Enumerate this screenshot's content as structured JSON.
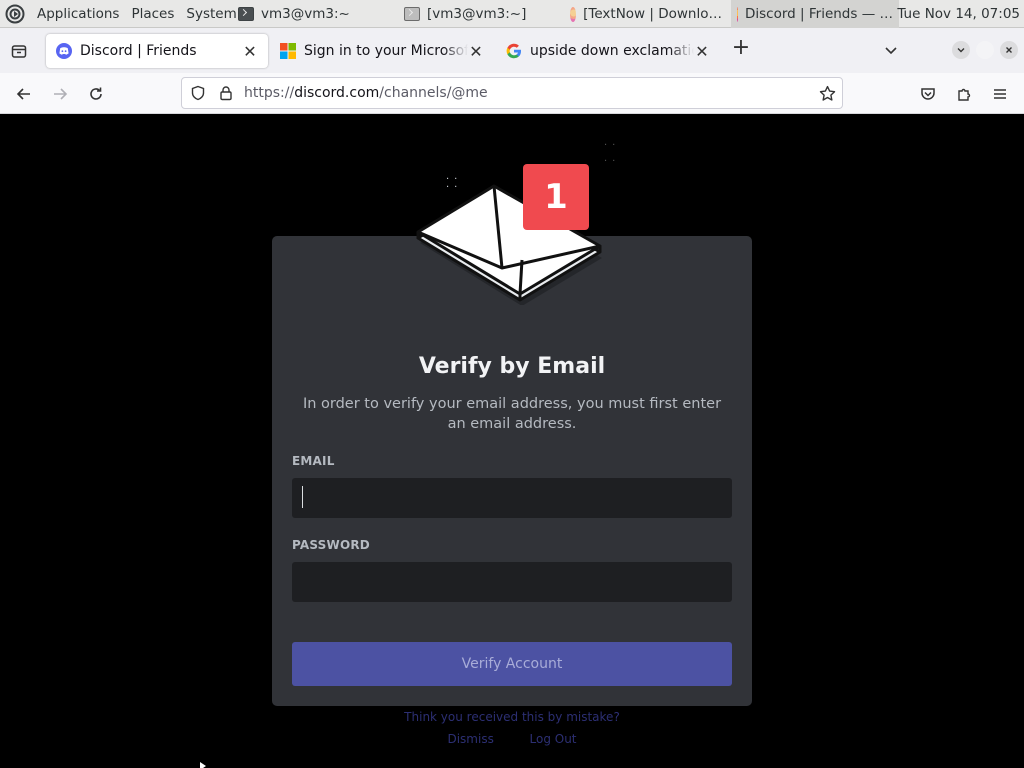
{
  "panel": {
    "menus": [
      "Applications",
      "Places",
      "System"
    ],
    "tasks": [
      {
        "label": "vm3@vm3:~",
        "icon": "terminal-icon"
      },
      {
        "label": "[vm3@vm3:~]",
        "icon": "terminal-icon"
      },
      {
        "label": "[TextNow | Downlo…",
        "icon": "firefox-icon"
      },
      {
        "label": "Discord | Friends — …",
        "icon": "firefox-icon"
      }
    ],
    "clock": "Tue Nov 14, 07:05"
  },
  "tabs": [
    {
      "title": "Discord | Friends",
      "favicon": "discord-icon",
      "selected": true
    },
    {
      "title": "Sign in to your Microsoft account",
      "favicon": "microsoft-icon",
      "selected": false
    },
    {
      "title": "upside down exclamation point",
      "favicon": "google-icon",
      "selected": false
    }
  ],
  "navbar": {
    "url_prefix": "https://",
    "url_host": "discord.com",
    "url_path": "/channels/@me"
  },
  "modal": {
    "badge_count": "1",
    "title": "Verify by Email",
    "description": "In order to verify your email address, you must first enter an email address.",
    "email_label": "EMAIL",
    "email_value": "",
    "password_label": "PASSWORD",
    "password_value": "",
    "button_label": "Verify Account"
  },
  "behind": {
    "line1": "Think you received this by mistake?",
    "link_left": "Dismiss",
    "link_right": "Log Out"
  },
  "colors": {
    "page_bg": "#000000",
    "modal_bg": "#313338",
    "input_bg": "#1e1f22",
    "button_bg": "#4c52a3",
    "badge_bg": "#f04a4f"
  }
}
